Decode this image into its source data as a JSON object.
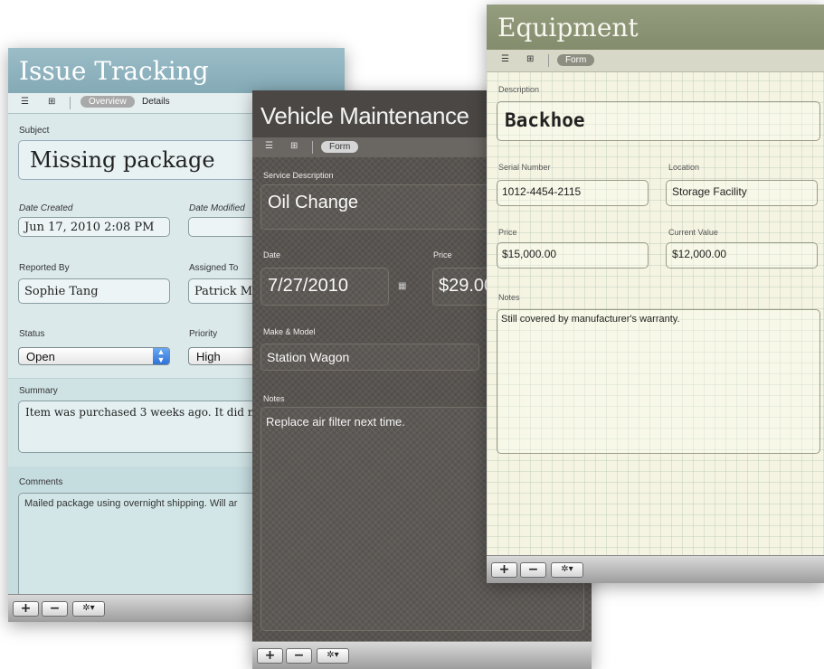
{
  "issue": {
    "title": "Issue Tracking",
    "tabs": {
      "overview": "Overview",
      "details": "Details"
    },
    "subject_label": "Subject",
    "subject": "Missing package",
    "date_created_label": "Date Created",
    "date_created": "Jun 17, 2010 2:08 PM",
    "date_modified_label": "Date Modified",
    "date_modified": "",
    "reported_by_label": "Reported By",
    "reported_by": "Sophie Tang",
    "assigned_to_label": "Assigned To",
    "assigned_to": "Patrick Mu",
    "status_label": "Status",
    "status": "Open",
    "priority_label": "Priority",
    "priority": "High",
    "summary_label": "Summary",
    "summary": "Item was purchased 3 weeks ago. It did not",
    "comments_label": "Comments",
    "comments": "Mailed package using overnight shipping. Will ar"
  },
  "vehicle": {
    "title": "Vehicle Maintenance",
    "form_tab": "Form",
    "service_label": "Service Description",
    "service": "Oil Change",
    "date_label": "Date",
    "date": "7/27/2010",
    "price_label": "Price",
    "price": "$29.00",
    "make_label": "Make & Model",
    "make": "Station Wagon",
    "notes_label": "Notes",
    "notes": "Replace air filter next time."
  },
  "equipment": {
    "title": "Equipment",
    "form_tab": "Form",
    "description_label": "Description",
    "description": "Backhoe",
    "serial_label": "Serial Number",
    "serial": "1012-4454-2115",
    "location_label": "Location",
    "location": "Storage Facility",
    "price_label": "Price",
    "price": "$15,000.00",
    "current_value_label": "Current Value",
    "current_value": "$12,000.00",
    "notes_label": "Notes",
    "notes": "Still covered by manufacturer's warranty."
  },
  "bottom_bar": {
    "add": "+",
    "remove": "−",
    "gear": "✲▾"
  },
  "icons": {
    "list_view": "list-view-icon",
    "grid_view": "grid-view-icon",
    "calendar": "calendar-icon",
    "gear": "gear-icon",
    "popup_arrows": "popup-arrows-icon"
  },
  "colors": {
    "issue_header": "#8fb3bf",
    "issue_body": "#cfe3e5",
    "vehicle_header": "#4a4744",
    "vehicle_body": "#585450",
    "equipment_header": "#8b9474",
    "equipment_body": "#f5f4e3"
  }
}
